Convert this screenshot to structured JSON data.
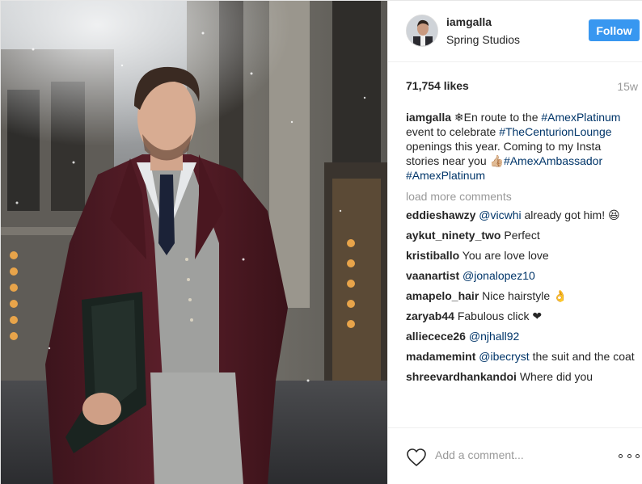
{
  "post": {
    "username": "iamgalla",
    "location": "Spring Studios",
    "follow_label": "Follow",
    "likes": "71,754 likes",
    "time_ago": "15w",
    "caption": {
      "username": "iamgalla",
      "parts": [
        {
          "type": "text",
          "value": " ❄En route to the "
        },
        {
          "type": "tag",
          "value": "#AmexPlatinum"
        },
        {
          "type": "text",
          "value": " event to celebrate "
        },
        {
          "type": "tag",
          "value": "#TheCenturionLounge"
        },
        {
          "type": "text",
          "value": " openings this year. Coming to my Insta stories near you 👍🏼"
        },
        {
          "type": "tag",
          "value": "#AmexAmbassador"
        },
        {
          "type": "text",
          "value": " "
        },
        {
          "type": "tag",
          "value": "#AmexPlatinum"
        }
      ]
    },
    "load_more_label": "load more comments",
    "comments": [
      {
        "user": "eddieshawzy",
        "parts": [
          {
            "type": "tag",
            "value": "@vicwhi"
          },
          {
            "type": "text",
            "value": " already got him! 😆"
          }
        ]
      },
      {
        "user": "aykut_ninety_two",
        "parts": [
          {
            "type": "text",
            "value": "Perfect"
          }
        ]
      },
      {
        "user": "kristiballo",
        "parts": [
          {
            "type": "text",
            "value": "You are love love"
          }
        ]
      },
      {
        "user": "vaanartist",
        "parts": [
          {
            "type": "tag",
            "value": "@jonalopez10"
          }
        ]
      },
      {
        "user": "amapelo_hair",
        "parts": [
          {
            "type": "text",
            "value": "Nice hairstyle 👌"
          }
        ]
      },
      {
        "user": "zaryab44",
        "parts": [
          {
            "type": "text",
            "value": "Fabulous click ❤"
          }
        ]
      },
      {
        "user": "alliecece26",
        "parts": [
          {
            "type": "tag",
            "value": "@njhall92"
          }
        ]
      },
      {
        "user": "madamemint",
        "parts": [
          {
            "type": "tag",
            "value": "@ibecryst"
          },
          {
            "type": "text",
            "value": " the suit and the coat"
          }
        ]
      },
      {
        "user": "shreevardhankandoi",
        "parts": [
          {
            "type": "text",
            "value": "Where did you"
          }
        ]
      }
    ],
    "add_comment_placeholder": "Add a comment...",
    "icons": {
      "like": "heart-outline-icon",
      "more": "more-options-icon"
    },
    "colors": {
      "follow_button": "#3897f0",
      "hashtag": "#003569",
      "muted": "#999999",
      "text": "#262626"
    }
  }
}
